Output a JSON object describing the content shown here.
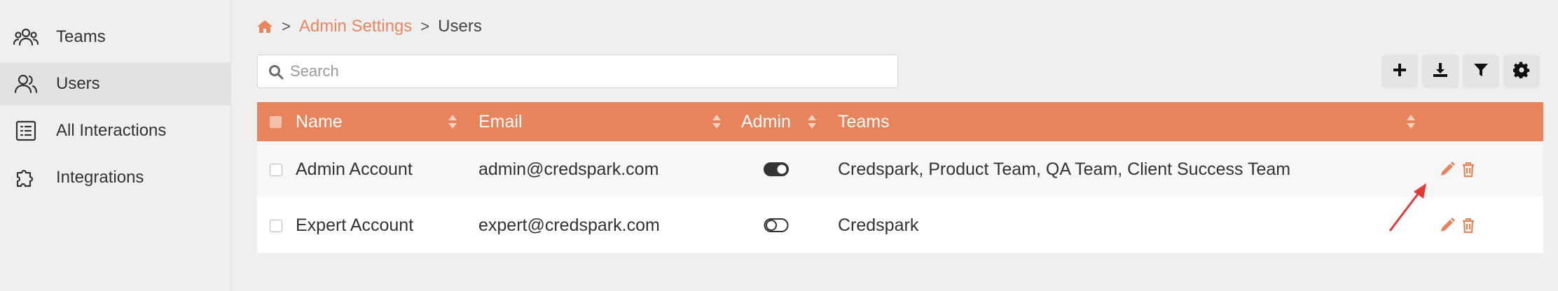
{
  "sidebar": {
    "items": [
      {
        "label": "Teams",
        "icon": "users-group-icon",
        "active": false
      },
      {
        "label": "Users",
        "icon": "users-icon",
        "active": true
      },
      {
        "label": "All Interactions",
        "icon": "list-icon",
        "active": false
      },
      {
        "label": "Integrations",
        "icon": "puzzle-icon",
        "active": false
      }
    ]
  },
  "breadcrumb": {
    "home_icon": "home-icon",
    "separator": ">",
    "parent": "Admin Settings",
    "current": "Users"
  },
  "search": {
    "placeholder": "Search",
    "value": ""
  },
  "toolbar": {
    "buttons": [
      "add-icon",
      "download-icon",
      "filter-icon",
      "settings-icon"
    ]
  },
  "table": {
    "columns": {
      "name": "Name",
      "email": "Email",
      "admin": "Admin",
      "teams": "Teams"
    },
    "rows": [
      {
        "name": "Admin Account",
        "email": "admin@credspark.com",
        "admin": true,
        "teams": "Credspark, Product Team, QA Team, Client Success Team"
      },
      {
        "name": "Expert Account",
        "email": "expert@credspark.com",
        "admin": false,
        "teams": "Credspark"
      }
    ]
  },
  "colors": {
    "accent": "#e8845c",
    "link": "#e8875e",
    "annotation_arrow": "#e53935"
  }
}
